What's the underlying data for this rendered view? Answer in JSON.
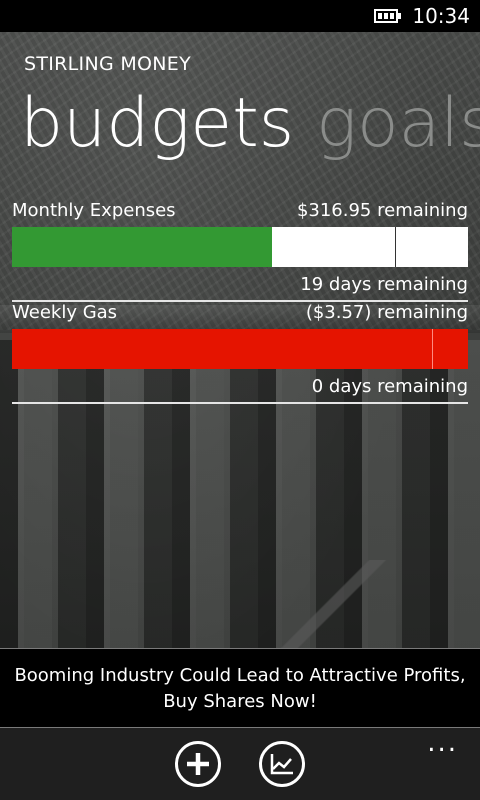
{
  "status_bar": {
    "time": "10:34",
    "battery_icon": "battery-charging-icon"
  },
  "app": {
    "title": "STIRLING MONEY",
    "pivots": [
      "budgets",
      "goals"
    ],
    "active_pivot": "budgets"
  },
  "budgets": [
    {
      "name": "Monthly Expenses",
      "remaining": "$316.95 remaining",
      "days": "19 days remaining",
      "spent_fraction": 0.57,
      "time_fraction": 0.84,
      "color": "#339933"
    },
    {
      "name": "Weekly Gas",
      "remaining": "($3.57) remaining",
      "days": "0 days remaining",
      "spent_fraction": 1.0,
      "time_fraction": 0.92,
      "color": "#e51400"
    }
  ],
  "ad": {
    "text": "Booming Industry Could Lead to Attractive Profits, Buy Shares Now!"
  },
  "app_bar": {
    "buttons": [
      {
        "icon": "add-icon"
      },
      {
        "icon": "chart-icon"
      }
    ],
    "more": "..."
  }
}
